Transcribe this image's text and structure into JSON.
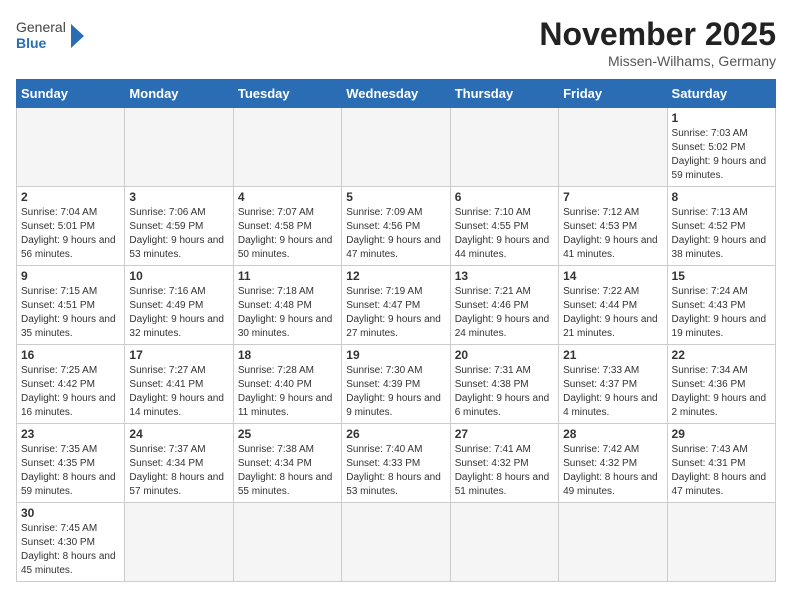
{
  "logo": {
    "text_general": "General",
    "text_blue": "Blue"
  },
  "title": "November 2025",
  "subtitle": "Missen-Wilhams, Germany",
  "days_of_week": [
    "Sunday",
    "Monday",
    "Tuesday",
    "Wednesday",
    "Thursday",
    "Friday",
    "Saturday"
  ],
  "weeks": [
    [
      {
        "day": "",
        "info": ""
      },
      {
        "day": "",
        "info": ""
      },
      {
        "day": "",
        "info": ""
      },
      {
        "day": "",
        "info": ""
      },
      {
        "day": "",
        "info": ""
      },
      {
        "day": "",
        "info": ""
      },
      {
        "day": "1",
        "info": "Sunrise: 7:03 AM\nSunset: 5:02 PM\nDaylight: 9 hours and 59 minutes."
      }
    ],
    [
      {
        "day": "2",
        "info": "Sunrise: 7:04 AM\nSunset: 5:01 PM\nDaylight: 9 hours and 56 minutes."
      },
      {
        "day": "3",
        "info": "Sunrise: 7:06 AM\nSunset: 4:59 PM\nDaylight: 9 hours and 53 minutes."
      },
      {
        "day": "4",
        "info": "Sunrise: 7:07 AM\nSunset: 4:58 PM\nDaylight: 9 hours and 50 minutes."
      },
      {
        "day": "5",
        "info": "Sunrise: 7:09 AM\nSunset: 4:56 PM\nDaylight: 9 hours and 47 minutes."
      },
      {
        "day": "6",
        "info": "Sunrise: 7:10 AM\nSunset: 4:55 PM\nDaylight: 9 hours and 44 minutes."
      },
      {
        "day": "7",
        "info": "Sunrise: 7:12 AM\nSunset: 4:53 PM\nDaylight: 9 hours and 41 minutes."
      },
      {
        "day": "8",
        "info": "Sunrise: 7:13 AM\nSunset: 4:52 PM\nDaylight: 9 hours and 38 minutes."
      }
    ],
    [
      {
        "day": "9",
        "info": "Sunrise: 7:15 AM\nSunset: 4:51 PM\nDaylight: 9 hours and 35 minutes."
      },
      {
        "day": "10",
        "info": "Sunrise: 7:16 AM\nSunset: 4:49 PM\nDaylight: 9 hours and 32 minutes."
      },
      {
        "day": "11",
        "info": "Sunrise: 7:18 AM\nSunset: 4:48 PM\nDaylight: 9 hours and 30 minutes."
      },
      {
        "day": "12",
        "info": "Sunrise: 7:19 AM\nSunset: 4:47 PM\nDaylight: 9 hours and 27 minutes."
      },
      {
        "day": "13",
        "info": "Sunrise: 7:21 AM\nSunset: 4:46 PM\nDaylight: 9 hours and 24 minutes."
      },
      {
        "day": "14",
        "info": "Sunrise: 7:22 AM\nSunset: 4:44 PM\nDaylight: 9 hours and 21 minutes."
      },
      {
        "day": "15",
        "info": "Sunrise: 7:24 AM\nSunset: 4:43 PM\nDaylight: 9 hours and 19 minutes."
      }
    ],
    [
      {
        "day": "16",
        "info": "Sunrise: 7:25 AM\nSunset: 4:42 PM\nDaylight: 9 hours and 16 minutes."
      },
      {
        "day": "17",
        "info": "Sunrise: 7:27 AM\nSunset: 4:41 PM\nDaylight: 9 hours and 14 minutes."
      },
      {
        "day": "18",
        "info": "Sunrise: 7:28 AM\nSunset: 4:40 PM\nDaylight: 9 hours and 11 minutes."
      },
      {
        "day": "19",
        "info": "Sunrise: 7:30 AM\nSunset: 4:39 PM\nDaylight: 9 hours and 9 minutes."
      },
      {
        "day": "20",
        "info": "Sunrise: 7:31 AM\nSunset: 4:38 PM\nDaylight: 9 hours and 6 minutes."
      },
      {
        "day": "21",
        "info": "Sunrise: 7:33 AM\nSunset: 4:37 PM\nDaylight: 9 hours and 4 minutes."
      },
      {
        "day": "22",
        "info": "Sunrise: 7:34 AM\nSunset: 4:36 PM\nDaylight: 9 hours and 2 minutes."
      }
    ],
    [
      {
        "day": "23",
        "info": "Sunrise: 7:35 AM\nSunset: 4:35 PM\nDaylight: 8 hours and 59 minutes."
      },
      {
        "day": "24",
        "info": "Sunrise: 7:37 AM\nSunset: 4:34 PM\nDaylight: 8 hours and 57 minutes."
      },
      {
        "day": "25",
        "info": "Sunrise: 7:38 AM\nSunset: 4:34 PM\nDaylight: 8 hours and 55 minutes."
      },
      {
        "day": "26",
        "info": "Sunrise: 7:40 AM\nSunset: 4:33 PM\nDaylight: 8 hours and 53 minutes."
      },
      {
        "day": "27",
        "info": "Sunrise: 7:41 AM\nSunset: 4:32 PM\nDaylight: 8 hours and 51 minutes."
      },
      {
        "day": "28",
        "info": "Sunrise: 7:42 AM\nSunset: 4:32 PM\nDaylight: 8 hours and 49 minutes."
      },
      {
        "day": "29",
        "info": "Sunrise: 7:43 AM\nSunset: 4:31 PM\nDaylight: 8 hours and 47 minutes."
      }
    ],
    [
      {
        "day": "30",
        "info": "Sunrise: 7:45 AM\nSunset: 4:30 PM\nDaylight: 8 hours and 45 minutes."
      },
      {
        "day": "",
        "info": ""
      },
      {
        "day": "",
        "info": ""
      },
      {
        "day": "",
        "info": ""
      },
      {
        "day": "",
        "info": ""
      },
      {
        "day": "",
        "info": ""
      },
      {
        "day": "",
        "info": ""
      }
    ]
  ]
}
